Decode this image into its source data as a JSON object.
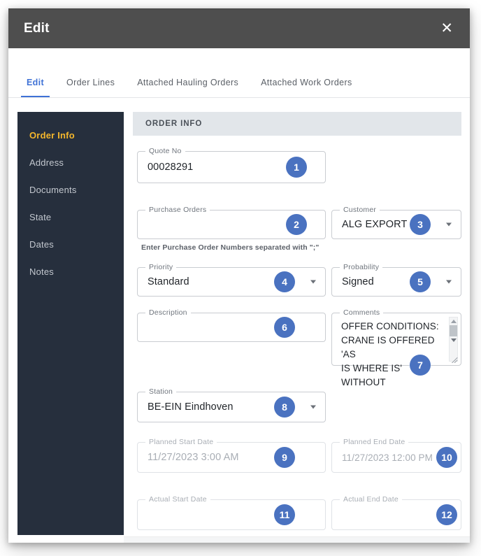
{
  "dialog": {
    "title": "Edit",
    "close_icon": "close-icon"
  },
  "tabs": [
    {
      "label": "Edit",
      "active": true
    },
    {
      "label": "Order Lines",
      "active": false
    },
    {
      "label": "Attached Hauling Orders",
      "active": false
    },
    {
      "label": "Attached Work Orders",
      "active": false
    }
  ],
  "sidebar": {
    "items": [
      {
        "label": "Order Info",
        "active": true
      },
      {
        "label": "Address",
        "active": false
      },
      {
        "label": "Documents",
        "active": false
      },
      {
        "label": "State",
        "active": false
      },
      {
        "label": "Dates",
        "active": false
      },
      {
        "label": "Notes",
        "active": false
      }
    ]
  },
  "section": {
    "header": "ORDER INFO"
  },
  "fields": {
    "quote_no": {
      "label": "Quote No",
      "value": "00028291",
      "badge": "1"
    },
    "purchase_orders": {
      "label": "Purchase Orders",
      "value": "",
      "hint": "Enter Purchase Order Numbers separated with \";\"",
      "badge": "2"
    },
    "customer": {
      "label": "Customer",
      "value": "ALG EXPORT",
      "badge": "3"
    },
    "priority": {
      "label": "Priority",
      "value": "Standard",
      "badge": "4"
    },
    "probability": {
      "label": "Probability",
      "value": "Signed",
      "badge": "5"
    },
    "description": {
      "label": "Description",
      "value": "",
      "badge": "6"
    },
    "comments": {
      "label": "Comments",
      "value": "OFFER CONDITIONS:\nCRANE IS OFFERED 'AS\nIS WHERE IS' WITHOUT",
      "badge": "7"
    },
    "station": {
      "label": "Station",
      "value": "BE-EIN Eindhoven",
      "badge": "8"
    },
    "planned_start_date": {
      "label": "Planned Start Date",
      "value": "11/27/2023 3:00 AM",
      "badge": "9"
    },
    "planned_end_date": {
      "label": "Planned End Date",
      "value": "11/27/2023 12:00 PM",
      "badge": "10"
    },
    "actual_start_date": {
      "label": "Actual Start Date",
      "value": "",
      "badge": "11"
    },
    "actual_end_date": {
      "label": "Actual End Date",
      "value": "",
      "badge": "12"
    }
  },
  "colors": {
    "titlebar": "#4e4e4e",
    "sidebar": "#262f3d",
    "sidebar_active": "#f5b72c",
    "tab_active": "#3f72d6",
    "badge": "#4a72c0",
    "section_header": "#e2e6ea"
  }
}
